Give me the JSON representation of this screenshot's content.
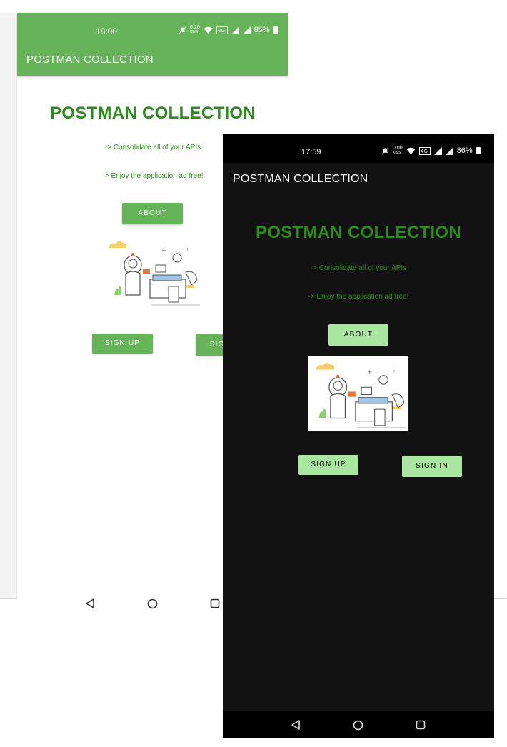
{
  "light_phone": {
    "status": {
      "time": "18:00",
      "speed": "0.20",
      "speed_unit": "KB/S",
      "battery": "85%"
    },
    "appbar_title": "POSTMAN COLLECTION",
    "title": "POSTMAN COLLECTION",
    "line1": "-> Consolidate all of your APIs",
    "line2": "-> Enjoy the application ad free!",
    "buttons": {
      "about": "ABOUT",
      "sign_up": "SIGN UP",
      "sign_in": "SIGN IN"
    },
    "icons": [
      "dnd-off-icon",
      "wifi-icon",
      "volte-icon",
      "signal-icon",
      "battery-icon"
    ]
  },
  "dark_phone": {
    "status": {
      "time": "17:59",
      "speed": "0.00",
      "speed_unit": "KB/S",
      "battery": "86%"
    },
    "appbar_title": "POSTMAN COLLECTION",
    "title": "POSTMAN COLLECTION",
    "line1": "-> Consolidate all of your APIs",
    "line2": "-> Enjoy the application ad free!",
    "buttons": {
      "about": "ABOUT",
      "sign_up": "SIGN UP",
      "sign_in": "SIGN IN"
    }
  },
  "nav_icons": [
    "back-icon",
    "home-icon",
    "recents-icon"
  ],
  "colors": {
    "primary": "#66b35a",
    "title_green": "#2e8b1e",
    "dark_button": "#a9e7a0",
    "dark_bg": "#121212"
  }
}
